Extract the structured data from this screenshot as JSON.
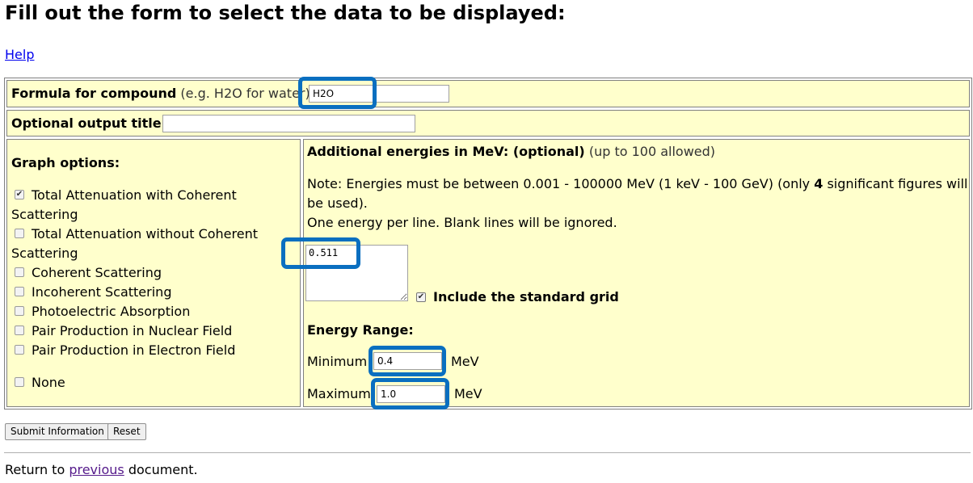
{
  "page": {
    "title": "Fill out the form to select the data to be displayed:",
    "help_link": "Help"
  },
  "formula": {
    "label_bold": "Formula for compound",
    "label_hint": "(e.g. H2O for water):",
    "value": "H2O"
  },
  "output_title": {
    "label": "Optional output title:",
    "value": ""
  },
  "graph_options": {
    "heading": "Graph options:",
    "items": [
      {
        "label_line1": "Total Attenuation with Coherent",
        "label_line2": "Scattering",
        "checked": true
      },
      {
        "label_line1": "Total Attenuation without Coherent",
        "label_line2": "Scattering",
        "checked": false
      },
      {
        "label_line1": "Coherent Scattering",
        "checked": false
      },
      {
        "label_line1": "Incoherent Scattering",
        "checked": false
      },
      {
        "label_line1": "Photoelectric Absorption",
        "checked": false
      },
      {
        "label_line1": "Pair Production in Nuclear Field",
        "checked": false
      },
      {
        "label_line1": "Pair Production in Electron Field",
        "checked": false
      }
    ],
    "none_label": "None",
    "none_checked": false
  },
  "energies": {
    "heading_bold": "Additional energies in MeV: (optional)",
    "heading_hint": "(up to 100 allowed)",
    "note_line1_pre": "Note: Energies must be between 0.001 - 100000 MeV (1 keV - 100 GeV) (only ",
    "note_line1_bold": "4",
    "note_line1_post": " significant figures will",
    "note_line2": "be used).",
    "note_line3": "One energy per line. Blank lines will be ignored.",
    "textarea_value": "0.511",
    "include_grid_label": "Include the standard grid",
    "include_grid_checked": true
  },
  "energy_range": {
    "heading": "Energy Range:",
    "min_label": "Minimum",
    "min_value": "0.4",
    "max_label": "Maximum",
    "max_value": "1.0",
    "unit": "MeV"
  },
  "buttons": {
    "submit": "Submit Information",
    "reset": "Reset"
  },
  "footer": {
    "pre": "Return to ",
    "link": "previous",
    "post": " document."
  },
  "colors": {
    "panel_bg": "#ffffcc",
    "highlight": "#0a6fc0",
    "link": "#0000ee",
    "visited_link": "#551a8b"
  }
}
